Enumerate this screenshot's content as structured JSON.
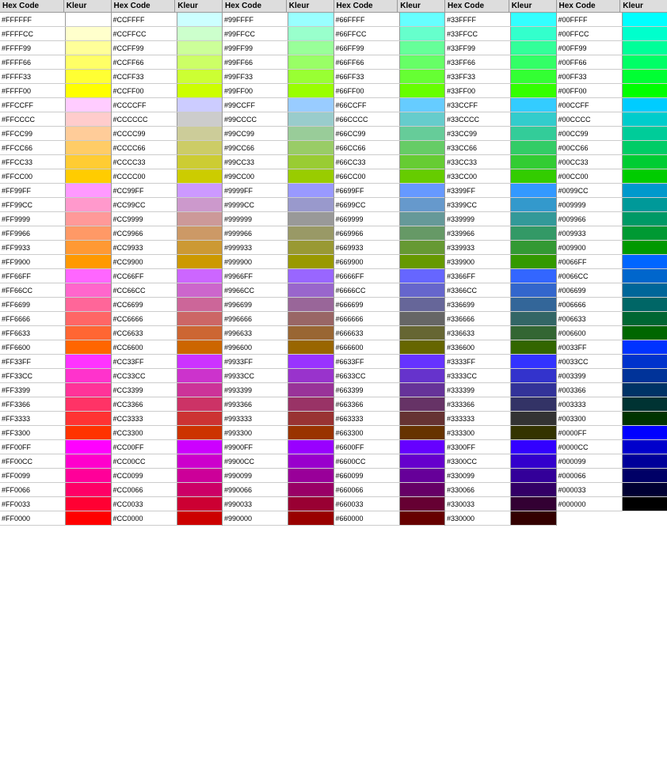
{
  "columns": [
    {
      "id": "col1",
      "header": {
        "hex": "Hex Code",
        "kleur": "Kleur"
      },
      "rows": [
        {
          "hex": "#FFFFFF",
          "color": "#FFFFFF"
        },
        {
          "hex": "#FFFFCC",
          "color": "#FFFFCC"
        },
        {
          "hex": "#FFFF99",
          "color": "#FFFF99"
        },
        {
          "hex": "#FFFF66",
          "color": "#FFFF66"
        },
        {
          "hex": "#FFFF33",
          "color": "#FFFF33"
        },
        {
          "hex": "#FFFF00",
          "color": "#FFFF00"
        },
        {
          "hex": "#FFCCFF",
          "color": "#FFCCFF"
        },
        {
          "hex": "#FFCCCC",
          "color": "#FFCCCC"
        },
        {
          "hex": "#FFCC99",
          "color": "#FFCC99"
        },
        {
          "hex": "#FFCC66",
          "color": "#FFCC66"
        },
        {
          "hex": "#FFCC33",
          "color": "#FFCC33"
        },
        {
          "hex": "#FFCC00",
          "color": "#FFCC00"
        },
        {
          "hex": "#FF99FF",
          "color": "#FF99FF"
        },
        {
          "hex": "#FF99CC",
          "color": "#FF99CC"
        },
        {
          "hex": "#FF9999",
          "color": "#FF9999"
        },
        {
          "hex": "#FF9966",
          "color": "#FF9966"
        },
        {
          "hex": "#FF9933",
          "color": "#FF9933"
        },
        {
          "hex": "#FF9900",
          "color": "#FF9900"
        },
        {
          "hex": "#FF66FF",
          "color": "#FF66FF"
        },
        {
          "hex": "#FF66CC",
          "color": "#FF66CC"
        },
        {
          "hex": "#FF6699",
          "color": "#FF6699"
        },
        {
          "hex": "#FF6666",
          "color": "#FF6666"
        },
        {
          "hex": "#FF6633",
          "color": "#FF6633"
        },
        {
          "hex": "#FF6600",
          "color": "#FF6600"
        },
        {
          "hex": "#FF33FF",
          "color": "#FF33FF"
        },
        {
          "hex": "#FF33CC",
          "color": "#FF33CC"
        },
        {
          "hex": "#FF3399",
          "color": "#FF3399"
        },
        {
          "hex": "#FF3366",
          "color": "#FF3366"
        },
        {
          "hex": "#FF3333",
          "color": "#FF3333"
        },
        {
          "hex": "#FF3300",
          "color": "#FF3300"
        },
        {
          "hex": "#FF00FF",
          "color": "#FF00FF"
        },
        {
          "hex": "#FF00CC",
          "color": "#FF00CC"
        },
        {
          "hex": "#FF0099",
          "color": "#FF0099"
        },
        {
          "hex": "#FF0066",
          "color": "#FF0066"
        },
        {
          "hex": "#FF0033",
          "color": "#FF0033"
        },
        {
          "hex": "#FF0000",
          "color": "#FF0000"
        }
      ]
    },
    {
      "id": "col2",
      "header": {
        "hex": "Hex Code",
        "kleur": "Kleur"
      },
      "rows": [
        {
          "hex": "#CCFFFF",
          "color": "#CCFFFF"
        },
        {
          "hex": "#CCFFCC",
          "color": "#CCFFCC"
        },
        {
          "hex": "#CCFF99",
          "color": "#CCFF99"
        },
        {
          "hex": "#CCFF66",
          "color": "#CCFF66"
        },
        {
          "hex": "#CCFF33",
          "color": "#CCFF33"
        },
        {
          "hex": "#CCFF00",
          "color": "#CCFF00"
        },
        {
          "hex": "#CCCCFF",
          "color": "#CCCCFF"
        },
        {
          "hex": "#CCCCCC",
          "color": "#CCCCCC"
        },
        {
          "hex": "#CCCC99",
          "color": "#CCCC99"
        },
        {
          "hex": "#CCCC66",
          "color": "#CCCC66"
        },
        {
          "hex": "#CCCC33",
          "color": "#CCCC33"
        },
        {
          "hex": "#CCCC00",
          "color": "#CCCC00"
        },
        {
          "hex": "#CC99FF",
          "color": "#CC99FF"
        },
        {
          "hex": "#CC99CC",
          "color": "#CC99CC"
        },
        {
          "hex": "#CC9999",
          "color": "#CC9999"
        },
        {
          "hex": "#CC9966",
          "color": "#CC9966"
        },
        {
          "hex": "#CC9933",
          "color": "#CC9933"
        },
        {
          "hex": "#CC9900",
          "color": "#CC9900"
        },
        {
          "hex": "#CC66FF",
          "color": "#CC66FF"
        },
        {
          "hex": "#CC66CC",
          "color": "#CC66CC"
        },
        {
          "hex": "#CC6699",
          "color": "#CC6699"
        },
        {
          "hex": "#CC6666",
          "color": "#CC6666"
        },
        {
          "hex": "#CC6633",
          "color": "#CC6633"
        },
        {
          "hex": "#CC6600",
          "color": "#CC6600"
        },
        {
          "hex": "#CC33FF",
          "color": "#CC33FF"
        },
        {
          "hex": "#CC33CC",
          "color": "#CC33CC"
        },
        {
          "hex": "#CC3399",
          "color": "#CC3399"
        },
        {
          "hex": "#CC3366",
          "color": "#CC3366"
        },
        {
          "hex": "#CC3333",
          "color": "#CC3333"
        },
        {
          "hex": "#CC3300",
          "color": "#CC3300"
        },
        {
          "hex": "#CC00FF",
          "color": "#CC00FF"
        },
        {
          "hex": "#CC00CC",
          "color": "#CC00CC"
        },
        {
          "hex": "#CC0099",
          "color": "#CC0099"
        },
        {
          "hex": "#CC0066",
          "color": "#CC0066"
        },
        {
          "hex": "#CC0033",
          "color": "#CC0033"
        },
        {
          "hex": "#CC0000",
          "color": "#CC0000"
        }
      ]
    },
    {
      "id": "col3",
      "header": {
        "hex": "Hex Code",
        "kleur": "Kleur"
      },
      "rows": [
        {
          "hex": "#99FFFF",
          "color": "#99FFFF"
        },
        {
          "hex": "#99FFCC",
          "color": "#99FFCC"
        },
        {
          "hex": "#99FF99",
          "color": "#99FF99"
        },
        {
          "hex": "#99FF66",
          "color": "#99FF66"
        },
        {
          "hex": "#99FF33",
          "color": "#99FF33"
        },
        {
          "hex": "#99FF00",
          "color": "#99FF00"
        },
        {
          "hex": "#99CCFF",
          "color": "#99CCFF"
        },
        {
          "hex": "#99CCCC",
          "color": "#99CCCC"
        },
        {
          "hex": "#99CC99",
          "color": "#99CC99"
        },
        {
          "hex": "#99CC66",
          "color": "#99CC66"
        },
        {
          "hex": "#99CC33",
          "color": "#99CC33"
        },
        {
          "hex": "#99CC00",
          "color": "#99CC00"
        },
        {
          "hex": "#9999FF",
          "color": "#9999FF"
        },
        {
          "hex": "#9999CC",
          "color": "#9999CC"
        },
        {
          "hex": "#999999",
          "color": "#999999"
        },
        {
          "hex": "#999966",
          "color": "#999966"
        },
        {
          "hex": "#999933",
          "color": "#999933"
        },
        {
          "hex": "#999900",
          "color": "#999900"
        },
        {
          "hex": "#9966FF",
          "color": "#9966FF"
        },
        {
          "hex": "#9966CC",
          "color": "#9966CC"
        },
        {
          "hex": "#996699",
          "color": "#996699"
        },
        {
          "hex": "#996666",
          "color": "#996666"
        },
        {
          "hex": "#996633",
          "color": "#996633"
        },
        {
          "hex": "#996600",
          "color": "#996600"
        },
        {
          "hex": "#9933FF",
          "color": "#9933FF"
        },
        {
          "hex": "#9933CC",
          "color": "#9933CC"
        },
        {
          "hex": "#993399",
          "color": "#993399"
        },
        {
          "hex": "#993366",
          "color": "#993366"
        },
        {
          "hex": "#993333",
          "color": "#993333"
        },
        {
          "hex": "#993300",
          "color": "#993300"
        },
        {
          "hex": "#9900FF",
          "color": "#9900FF"
        },
        {
          "hex": "#9900CC",
          "color": "#9900CC"
        },
        {
          "hex": "#990099",
          "color": "#990099"
        },
        {
          "hex": "#990066",
          "color": "#990066"
        },
        {
          "hex": "#990033",
          "color": "#990033"
        },
        {
          "hex": "#990000",
          "color": "#990000"
        }
      ]
    },
    {
      "id": "col4",
      "header": {
        "hex": "Hex Code",
        "kleur": "Kleur"
      },
      "rows": [
        {
          "hex": "#66FFFF",
          "color": "#66FFFF"
        },
        {
          "hex": "#66FFCC",
          "color": "#66FFCC"
        },
        {
          "hex": "#66FF99",
          "color": "#66FF99"
        },
        {
          "hex": "#66FF66",
          "color": "#66FF66"
        },
        {
          "hex": "#66FF33",
          "color": "#66FF33"
        },
        {
          "hex": "#66FF00",
          "color": "#66FF00"
        },
        {
          "hex": "#66CCFF",
          "color": "#66CCFF"
        },
        {
          "hex": "#66CCCC",
          "color": "#66CCCC"
        },
        {
          "hex": "#66CC99",
          "color": "#66CC99"
        },
        {
          "hex": "#66CC66",
          "color": "#66CC66"
        },
        {
          "hex": "#66CC33",
          "color": "#66CC33"
        },
        {
          "hex": "#66CC00",
          "color": "#66CC00"
        },
        {
          "hex": "#6699FF",
          "color": "#6699FF"
        },
        {
          "hex": "#6699CC",
          "color": "#6699CC"
        },
        {
          "hex": "#669999",
          "color": "#669999"
        },
        {
          "hex": "#669966",
          "color": "#669966"
        },
        {
          "hex": "#669933",
          "color": "#669933"
        },
        {
          "hex": "#669900",
          "color": "#669900"
        },
        {
          "hex": "#6666FF",
          "color": "#6666FF"
        },
        {
          "hex": "#6666CC",
          "color": "#6666CC"
        },
        {
          "hex": "#666699",
          "color": "#666699"
        },
        {
          "hex": "#666666",
          "color": "#666666"
        },
        {
          "hex": "#666633",
          "color": "#666633"
        },
        {
          "hex": "#666600",
          "color": "#666600"
        },
        {
          "hex": "#6633FF",
          "color": "#6633FF"
        },
        {
          "hex": "#6633CC",
          "color": "#6633CC"
        },
        {
          "hex": "#663399",
          "color": "#663399"
        },
        {
          "hex": "#663366",
          "color": "#663366"
        },
        {
          "hex": "#663333",
          "color": "#663333"
        },
        {
          "hex": "#663300",
          "color": "#663300"
        },
        {
          "hex": "#6600FF",
          "color": "#6600FF"
        },
        {
          "hex": "#6600CC",
          "color": "#6600CC"
        },
        {
          "hex": "#660099",
          "color": "#660099"
        },
        {
          "hex": "#660066",
          "color": "#660066"
        },
        {
          "hex": "#660033",
          "color": "#660033"
        },
        {
          "hex": "#660000",
          "color": "#660000"
        }
      ]
    },
    {
      "id": "col5",
      "header": {
        "hex": "Hex Code",
        "kleur": "Kleur"
      },
      "rows": [
        {
          "hex": "#33FFFF",
          "color": "#33FFFF"
        },
        {
          "hex": "#33FFCC",
          "color": "#33FFCC"
        },
        {
          "hex": "#33FF99",
          "color": "#33FF99"
        },
        {
          "hex": "#33FF66",
          "color": "#33FF66"
        },
        {
          "hex": "#33FF33",
          "color": "#33FF33"
        },
        {
          "hex": "#33FF00",
          "color": "#33FF00"
        },
        {
          "hex": "#33CCFF",
          "color": "#33CCFF"
        },
        {
          "hex": "#33CCCC",
          "color": "#33CCCC"
        },
        {
          "hex": "#33CC99",
          "color": "#33CC99"
        },
        {
          "hex": "#33CC66",
          "color": "#33CC66"
        },
        {
          "hex": "#33CC33",
          "color": "#33CC33"
        },
        {
          "hex": "#33CC00",
          "color": "#33CC00"
        },
        {
          "hex": "#3399FF",
          "color": "#3399FF"
        },
        {
          "hex": "#3399CC",
          "color": "#3399CC"
        },
        {
          "hex": "#339999",
          "color": "#339999"
        },
        {
          "hex": "#339966",
          "color": "#339966"
        },
        {
          "hex": "#339933",
          "color": "#339933"
        },
        {
          "hex": "#339900",
          "color": "#339900"
        },
        {
          "hex": "#3366FF",
          "color": "#3366FF"
        },
        {
          "hex": "#3366CC",
          "color": "#3366CC"
        },
        {
          "hex": "#336699",
          "color": "#336699"
        },
        {
          "hex": "#336666",
          "color": "#336666"
        },
        {
          "hex": "#336633",
          "color": "#336633"
        },
        {
          "hex": "#336600",
          "color": "#336600"
        },
        {
          "hex": "#3333FF",
          "color": "#3333FF"
        },
        {
          "hex": "#3333CC",
          "color": "#3333CC"
        },
        {
          "hex": "#333399",
          "color": "#333399"
        },
        {
          "hex": "#333366",
          "color": "#333366"
        },
        {
          "hex": "#333333",
          "color": "#333333"
        },
        {
          "hex": "#333300",
          "color": "#333300"
        },
        {
          "hex": "#3300FF",
          "color": "#3300FF"
        },
        {
          "hex": "#3300CC",
          "color": "#3300CC"
        },
        {
          "hex": "#330099",
          "color": "#330099"
        },
        {
          "hex": "#330066",
          "color": "#330066"
        },
        {
          "hex": "#330033",
          "color": "#330033"
        },
        {
          "hex": "#330000",
          "color": "#330000"
        }
      ]
    },
    {
      "id": "col6",
      "header": {
        "hex": "Hex Code",
        "kleur": "Kleur"
      },
      "rows": [
        {
          "hex": "#00FFFF",
          "color": "#00FFFF"
        },
        {
          "hex": "#00FFCC",
          "color": "#00FFCC"
        },
        {
          "hex": "#00FF99",
          "color": "#00FF99"
        },
        {
          "hex": "#00FF66",
          "color": "#00FF66"
        },
        {
          "hex": "#00FF33",
          "color": "#00FF33"
        },
        {
          "hex": "#00FF00",
          "color": "#00FF00"
        },
        {
          "hex": "#00CCFF",
          "color": "#00CCFF"
        },
        {
          "hex": "#00CCCC",
          "color": "#00CCCC"
        },
        {
          "hex": "#00CC99",
          "color": "#00CC99"
        },
        {
          "hex": "#00CC66",
          "color": "#00CC66"
        },
        {
          "hex": "#00CC33",
          "color": "#00CC33"
        },
        {
          "hex": "#00CC00",
          "color": "#00CC00"
        },
        {
          "hex": "#0099CC",
          "color": "#0099CC"
        },
        {
          "hex": "#009999",
          "color": "#009999"
        },
        {
          "hex": "#009966",
          "color": "#009966"
        },
        {
          "hex": "#009933",
          "color": "#009933"
        },
        {
          "hex": "#009900",
          "color": "#009900"
        },
        {
          "hex": "#0066FF",
          "color": "#0066FF"
        },
        {
          "hex": "#0066CC",
          "color": "#0066CC"
        },
        {
          "hex": "#006699",
          "color": "#006699"
        },
        {
          "hex": "#006666",
          "color": "#006666"
        },
        {
          "hex": "#006633",
          "color": "#006633"
        },
        {
          "hex": "#006600",
          "color": "#006600"
        },
        {
          "hex": "#0033FF",
          "color": "#0033FF"
        },
        {
          "hex": "#0033CC",
          "color": "#0033CC"
        },
        {
          "hex": "#003399",
          "color": "#003399"
        },
        {
          "hex": "#003366",
          "color": "#003366"
        },
        {
          "hex": "#003333",
          "color": "#003333"
        },
        {
          "hex": "#003300",
          "color": "#003300"
        },
        {
          "hex": "#0000FF",
          "color": "#0000FF"
        },
        {
          "hex": "#0000CC",
          "color": "#0000CC"
        },
        {
          "hex": "#000099",
          "color": "#000099"
        },
        {
          "hex": "#000066",
          "color": "#000066"
        },
        {
          "hex": "#000033",
          "color": "#000033"
        },
        {
          "hex": "#000000",
          "color": "#000000"
        }
      ]
    }
  ]
}
